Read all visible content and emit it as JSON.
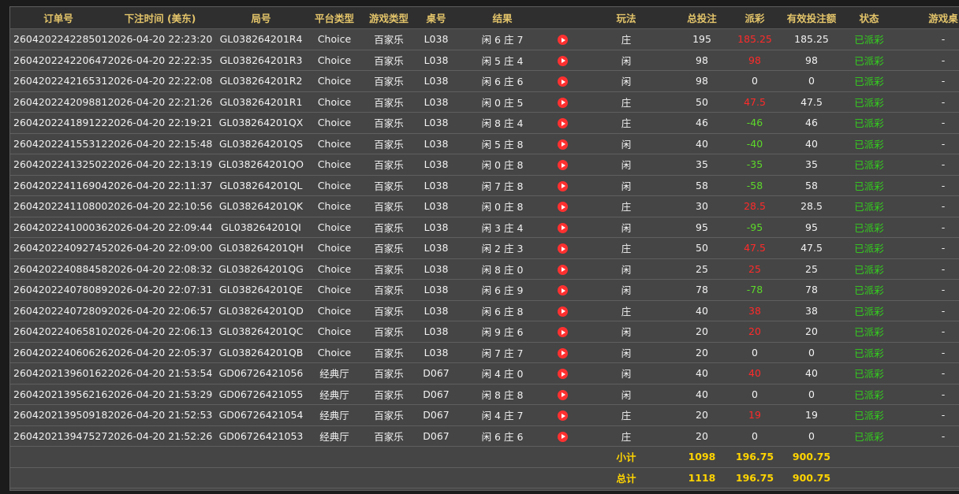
{
  "headers": [
    "订单号",
    "下注时间 (美东)",
    "局号",
    "平台类型",
    "游戏类型",
    "桌号",
    "结果",
    "",
    "玩法",
    "总投注",
    "派彩",
    "有效投注额",
    "状态",
    "游戏桌"
  ],
  "rows": [
    {
      "order": "260420224228501",
      "time": "2026-04-20 22:23:20",
      "round": "GL038264201R4",
      "platform": "Choice",
      "game": "百家乐",
      "table": "L038",
      "result": "闲 6 庄 7",
      "bet": "庄",
      "total": "195",
      "payout": "185.25",
      "payout_color": "red",
      "valid": "185.25",
      "status": "已派彩",
      "extra": "-"
    },
    {
      "order": "260420224220647",
      "time": "2026-04-20 22:22:35",
      "round": "GL038264201R3",
      "platform": "Choice",
      "game": "百家乐",
      "table": "L038",
      "result": "闲 5 庄 4",
      "bet": "闲",
      "total": "98",
      "payout": "98",
      "payout_color": "red",
      "valid": "98",
      "status": "已派彩",
      "extra": "-"
    },
    {
      "order": "260420224216531",
      "time": "2026-04-20 22:22:08",
      "round": "GL038264201R2",
      "platform": "Choice",
      "game": "百家乐",
      "table": "L038",
      "result": "闲 6 庄 6",
      "bet": "闲",
      "total": "98",
      "payout": "0",
      "payout_color": "white",
      "valid": "0",
      "status": "已派彩",
      "extra": "-"
    },
    {
      "order": "260420224209881",
      "time": "2026-04-20 22:21:26",
      "round": "GL038264201R1",
      "platform": "Choice",
      "game": "百家乐",
      "table": "L038",
      "result": "闲 0 庄 5",
      "bet": "庄",
      "total": "50",
      "payout": "47.5",
      "payout_color": "red",
      "valid": "47.5",
      "status": "已派彩",
      "extra": "-"
    },
    {
      "order": "260420224189122",
      "time": "2026-04-20 22:19:21",
      "round": "GL038264201QX",
      "platform": "Choice",
      "game": "百家乐",
      "table": "L038",
      "result": "闲 8 庄 4",
      "bet": "庄",
      "total": "46",
      "payout": "-46",
      "payout_color": "green",
      "valid": "46",
      "status": "已派彩",
      "extra": "-"
    },
    {
      "order": "260420224155312",
      "time": "2026-04-20 22:15:48",
      "round": "GL038264201QS",
      "platform": "Choice",
      "game": "百家乐",
      "table": "L038",
      "result": "闲 5 庄 8",
      "bet": "闲",
      "total": "40",
      "payout": "-40",
      "payout_color": "green",
      "valid": "40",
      "status": "已派彩",
      "extra": "-"
    },
    {
      "order": "260420224132502",
      "time": "2026-04-20 22:13:19",
      "round": "GL038264201QO",
      "platform": "Choice",
      "game": "百家乐",
      "table": "L038",
      "result": "闲 0 庄 8",
      "bet": "闲",
      "total": "35",
      "payout": "-35",
      "payout_color": "green",
      "valid": "35",
      "status": "已派彩",
      "extra": "-"
    },
    {
      "order": "260420224116904",
      "time": "2026-04-20 22:11:37",
      "round": "GL038264201QL",
      "platform": "Choice",
      "game": "百家乐",
      "table": "L038",
      "result": "闲 7 庄 8",
      "bet": "闲",
      "total": "58",
      "payout": "-58",
      "payout_color": "green",
      "valid": "58",
      "status": "已派彩",
      "extra": "-"
    },
    {
      "order": "260420224110800",
      "time": "2026-04-20 22:10:56",
      "round": "GL038264201QK",
      "platform": "Choice",
      "game": "百家乐",
      "table": "L038",
      "result": "闲 0 庄 8",
      "bet": "庄",
      "total": "30",
      "payout": "28.5",
      "payout_color": "red",
      "valid": "28.5",
      "status": "已派彩",
      "extra": "-"
    },
    {
      "order": "260420224100036",
      "time": "2026-04-20 22:09:44",
      "round": "GL038264201QI",
      "platform": "Choice",
      "game": "百家乐",
      "table": "L038",
      "result": "闲 3 庄 4",
      "bet": "闲",
      "total": "95",
      "payout": "-95",
      "payout_color": "green",
      "valid": "95",
      "status": "已派彩",
      "extra": "-"
    },
    {
      "order": "260420224092745",
      "time": "2026-04-20 22:09:00",
      "round": "GL038264201QH",
      "platform": "Choice",
      "game": "百家乐",
      "table": "L038",
      "result": "闲 2 庄 3",
      "bet": "庄",
      "total": "50",
      "payout": "47.5",
      "payout_color": "red",
      "valid": "47.5",
      "status": "已派彩",
      "extra": "-"
    },
    {
      "order": "260420224088458",
      "time": "2026-04-20 22:08:32",
      "round": "GL038264201QG",
      "platform": "Choice",
      "game": "百家乐",
      "table": "L038",
      "result": "闲 8 庄 0",
      "bet": "闲",
      "total": "25",
      "payout": "25",
      "payout_color": "red",
      "valid": "25",
      "status": "已派彩",
      "extra": "-"
    },
    {
      "order": "260420224078089",
      "time": "2026-04-20 22:07:31",
      "round": "GL038264201QE",
      "platform": "Choice",
      "game": "百家乐",
      "table": "L038",
      "result": "闲 6 庄 9",
      "bet": "闲",
      "total": "78",
      "payout": "-78",
      "payout_color": "green",
      "valid": "78",
      "status": "已派彩",
      "extra": "-"
    },
    {
      "order": "260420224072809",
      "time": "2026-04-20 22:06:57",
      "round": "GL038264201QD",
      "platform": "Choice",
      "game": "百家乐",
      "table": "L038",
      "result": "闲 6 庄 8",
      "bet": "庄",
      "total": "40",
      "payout": "38",
      "payout_color": "red",
      "valid": "38",
      "status": "已派彩",
      "extra": "-"
    },
    {
      "order": "260420224065810",
      "time": "2026-04-20 22:06:13",
      "round": "GL038264201QC",
      "platform": "Choice",
      "game": "百家乐",
      "table": "L038",
      "result": "闲 9 庄 6",
      "bet": "闲",
      "total": "20",
      "payout": "20",
      "payout_color": "red",
      "valid": "20",
      "status": "已派彩",
      "extra": "-"
    },
    {
      "order": "260420224060626",
      "time": "2026-04-20 22:05:37",
      "round": "GL038264201QB",
      "platform": "Choice",
      "game": "百家乐",
      "table": "L038",
      "result": "闲 7 庄 7",
      "bet": "闲",
      "total": "20",
      "payout": "0",
      "payout_color": "white",
      "valid": "0",
      "status": "已派彩",
      "extra": "-"
    },
    {
      "order": "260420213960162",
      "time": "2026-04-20 21:53:54",
      "round": "GD06726421056",
      "platform": "经典厅",
      "game": "百家乐",
      "table": "D067",
      "result": "闲 4 庄 0",
      "bet": "闲",
      "total": "40",
      "payout": "40",
      "payout_color": "red",
      "valid": "40",
      "status": "已派彩",
      "extra": "-"
    },
    {
      "order": "260420213956216",
      "time": "2026-04-20 21:53:29",
      "round": "GD06726421055",
      "platform": "经典厅",
      "game": "百家乐",
      "table": "D067",
      "result": "闲 8 庄 8",
      "bet": "闲",
      "total": "40",
      "payout": "0",
      "payout_color": "white",
      "valid": "0",
      "status": "已派彩",
      "extra": "-"
    },
    {
      "order": "260420213950918",
      "time": "2026-04-20 21:52:53",
      "round": "GD06726421054",
      "platform": "经典厅",
      "game": "百家乐",
      "table": "D067",
      "result": "闲 4 庄 7",
      "bet": "庄",
      "total": "20",
      "payout": "19",
      "payout_color": "red",
      "valid": "19",
      "status": "已派彩",
      "extra": "-"
    },
    {
      "order": "260420213947527",
      "time": "2026-04-20 21:52:26",
      "round": "GD06726421053",
      "platform": "经典厅",
      "game": "百家乐",
      "table": "D067",
      "result": "闲 6 庄 6",
      "bet": "庄",
      "total": "20",
      "payout": "0",
      "payout_color": "white",
      "valid": "0",
      "status": "已派彩",
      "extra": "-"
    }
  ],
  "subtotal": {
    "label": "小计",
    "total": "1098",
    "payout": "196.75",
    "valid": "900.75"
  },
  "grandtotal": {
    "label": "总计",
    "total": "1118",
    "payout": "196.75",
    "valid": "900.75"
  },
  "icons": {
    "replay": "play-icon"
  },
  "colors": {
    "header": "#e3c46a",
    "win": "#ff2a2a",
    "lose": "#5cd92a",
    "status": "#33d11d",
    "summary": "#ffd400"
  }
}
